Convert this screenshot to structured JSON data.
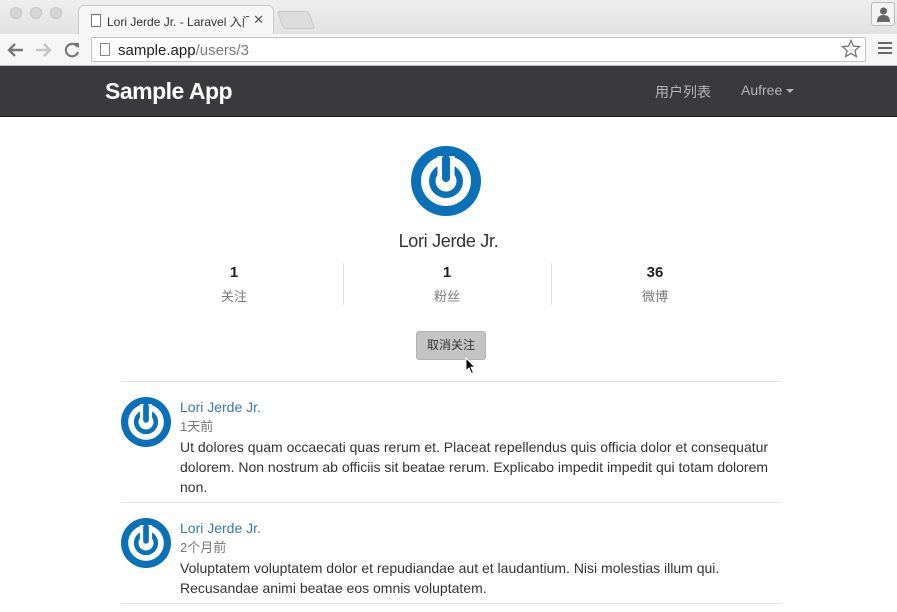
{
  "browser": {
    "tab_title": "Lori Jerde Jr. - Laravel 入门",
    "url_host": "sample.app",
    "url_path": "/users/3"
  },
  "navbar": {
    "brand": "Sample App",
    "links": {
      "users": "用户列表",
      "account": "Aufree"
    }
  },
  "profile": {
    "name": "Lori Jerde Jr.",
    "stats": [
      {
        "value": "1",
        "label": "关注"
      },
      {
        "value": "1",
        "label": "粉丝"
      },
      {
        "value": "36",
        "label": "微博"
      }
    ],
    "unfollow_label": "取消关注"
  },
  "statuses": [
    {
      "author": "Lori Jerde Jr.",
      "time": "1天前",
      "content": "Ut dolores quam occaecati quas rerum et. Placeat repellendus quis officia dolor et consequatur dolorem. Non nostrum ab officiis sit beatae rerum. Explicabo impedit impedit qui totam dolorem non."
    },
    {
      "author": "Lori Jerde Jr.",
      "time": "2个月前",
      "content": "Voluptatem voluptatem dolor et repudiandae aut et laudantium. Nisi molestias illum qui. Recusandae animi beatae eos omnis voluptatem."
    }
  ],
  "colors": {
    "navbar_bg": "#3a3a3d",
    "link_blue": "#337ab7",
    "avatar_blue": "#0a70b8"
  }
}
